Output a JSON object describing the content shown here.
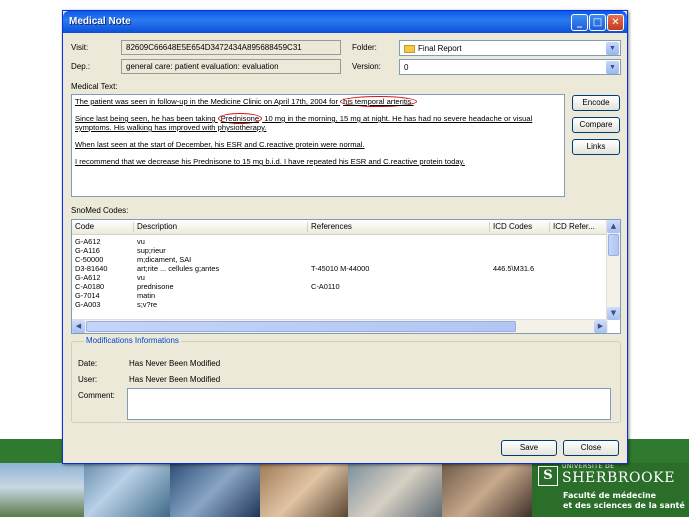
{
  "window": {
    "title": "Medical Note",
    "controls": [
      "minimize",
      "maximize",
      "close"
    ]
  },
  "header": {
    "visit_label": "Visit:",
    "visit_value": "82609C66648E5E654D3472434A895688459C31",
    "dep_label": "Dep.:",
    "dep_value": "general care: patient evaluation: evaluation",
    "folder_label": "Folder:",
    "folder_value": "Final Report",
    "version_label": "Version:",
    "version_value": "0"
  },
  "medical_text": {
    "label": "Medical Text:",
    "p1_a": "The patient was seen in follow-up in the Medicine Clinic on April 17th, 2004 for ",
    "p1_hl": "his temporal arteritis.",
    "p2_a": "Since last being seen, he has been taking ",
    "p2_hl": "Prednisone",
    "p2_b": " 10 mg in the morning, 15 mg at night. He has had no severe headache or visual symptoms. His walking has improved with physiotherapy.",
    "p3": "When last seen at the start of December, his ESR and C.reactive protein were normal.",
    "p4": "I recommend that we decrease his Prednisone to 15 mg b.i.d. I have repeated his ESR and C.reactive protein today."
  },
  "side_buttons": {
    "encode": "Encode",
    "compare": "Compare",
    "links": "Links"
  },
  "snomed": {
    "label": "SnoMed Codes:",
    "columns": [
      "Code",
      "Description",
      "References",
      "ICD Codes",
      "ICD Refer..."
    ],
    "rows": [
      {
        "code": "G-A612",
        "desc": "vu",
        "refs": "",
        "icd": "",
        "icdref": ""
      },
      {
        "code": "G-A116",
        "desc": "sup;rieur",
        "refs": "",
        "icd": "",
        "icdref": ""
      },
      {
        "code": "C-50000",
        "desc": "m;dicament, SAI",
        "refs": "",
        "icd": "",
        "icdref": ""
      },
      {
        "code": "D3-81640",
        "desc": "art;rite ... cellules g;antes",
        "refs": "T-45010 M-44000",
        "icd": "446.5\\M31.6",
        "icdref": ""
      },
      {
        "code": "G-A612",
        "desc": "vu",
        "refs": "",
        "icd": "",
        "icdref": ""
      },
      {
        "code": "C-A0180",
        "desc": "prednisone",
        "refs": "C-A0110",
        "icd": "",
        "icdref": ""
      },
      {
        "code": "G-7014",
        "desc": "matin",
        "refs": "",
        "icd": "",
        "icdref": ""
      },
      {
        "code": "G-A003",
        "desc": "s;v?re",
        "refs": "",
        "icd": "",
        "icdref": ""
      }
    ]
  },
  "modifications": {
    "title": "Modifications Informations",
    "date_label": "Date:",
    "date_value": "Has Never Been Modified",
    "user_label": "User:",
    "user_value": "Has Never Been Modified",
    "comment_label": "Comment:",
    "comment_value": ""
  },
  "footer_buttons": {
    "save": "Save",
    "close": "Close"
  },
  "branding": {
    "small": "UNIVERSITÉ DE",
    "name": "SHERBROOKE",
    "faculty_line1": "Faculté de médecine",
    "faculty_line2": "et des sciences de la santé"
  },
  "colors": {
    "title_bar": "#0a58e8",
    "highlight_circle": "#d11111",
    "group_title": "#0046d5",
    "university_green": "#2a6e2a"
  }
}
